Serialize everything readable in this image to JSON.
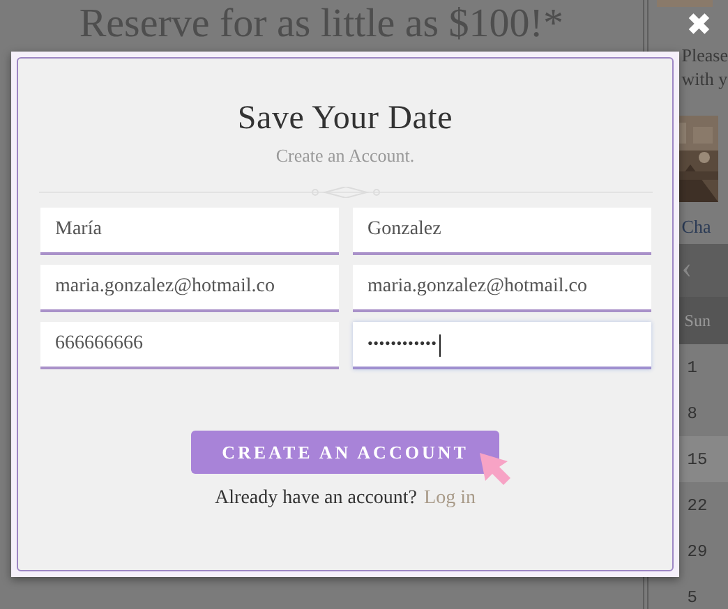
{
  "page": {
    "heading": "Reserve for as little as $100!*",
    "sidebar": {
      "lines": [
        "Please",
        "with y"
      ],
      "link": "Cha",
      "calendar_nav": "‹",
      "weekday": "Sun",
      "dates": [
        "1",
        "8",
        "15",
        "22",
        "29",
        "5"
      ]
    }
  },
  "modal": {
    "close": "✖",
    "title": "Save Your Date",
    "subtitle": "Create an Account.",
    "fields": [
      {
        "value": "María",
        "focused": false
      },
      {
        "value": "Gonzalez",
        "focused": false
      },
      {
        "value": "maria.gonzalez@hotmail.co",
        "focused": false
      },
      {
        "value": "maria.gonzalez@hotmail.co",
        "focused": false
      },
      {
        "value": "666666666",
        "focused": false
      },
      {
        "value": "••••••••••••",
        "focused": true
      }
    ],
    "button": "CREATE AN ACCOUNT",
    "login_prompt": "Already have an account?",
    "login_link": "Log in"
  }
}
